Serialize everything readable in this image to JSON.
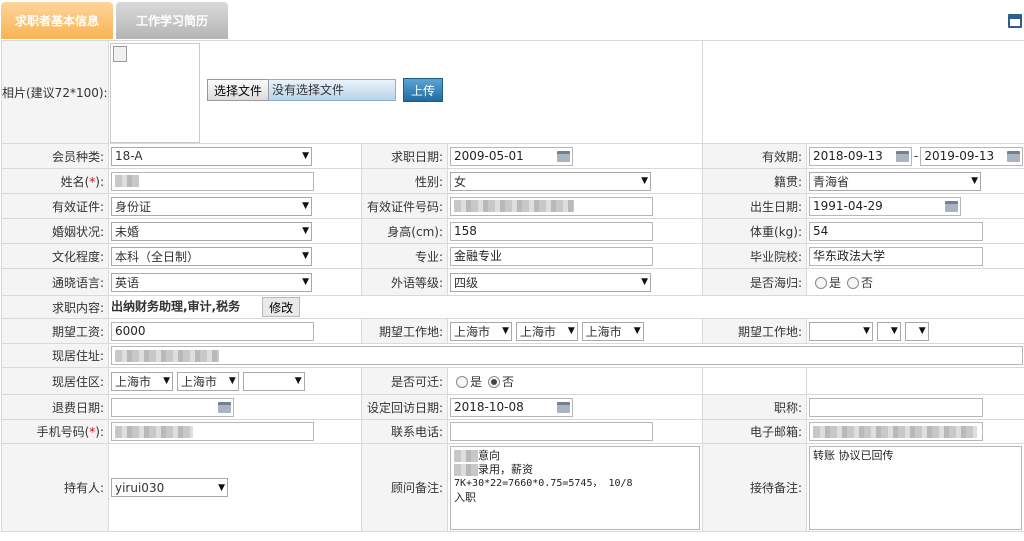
{
  "tabs": [
    "求职者基本信息",
    "工作学习简历"
  ],
  "photo": {
    "label": "相片(建议72*100):",
    "choose_btn": "选择文件",
    "no_file": "没有选择文件",
    "upload_btn": "上传"
  },
  "labels": {
    "member_type": "会员种类:",
    "apply_date": "求职日期:",
    "valid_period": "有效期:",
    "name_pre": "姓名(",
    "name_star": "*",
    "name_post": "):",
    "gender": "性别:",
    "native": "籍贯:",
    "id_type": "有效证件:",
    "id_number": "有效证件号码:",
    "birth": "出生日期:",
    "marital": "婚姻状况:",
    "height": "身高(cm):",
    "weight": "体重(kg):",
    "education": "文化程度:",
    "major": "专业:",
    "school": "毕业院校:",
    "language": "通晓语言:",
    "foreign_level": "外语等级:",
    "overseas": "是否海归:",
    "job_content": "求职内容:",
    "expected_salary": "期望工资:",
    "expected_place": "期望工作地:",
    "address": "现居住址:",
    "district": "现居住区:",
    "relocate": "是否可迁:",
    "refund_date": "退费日期:",
    "callback_date": "设定回访日期:",
    "title": "职称:",
    "mobile_pre": "手机号码(",
    "mobile_star": "*",
    "mobile_post": "):",
    "phone": "联系电话:",
    "email": "电子邮箱:",
    "holder": "持有人:",
    "consultant_note": "顾问备注:",
    "reception_note": "接待备注:",
    "yes": "是",
    "no": "否",
    "dash": "-"
  },
  "values": {
    "member_type": "18-A",
    "apply_date": "2009-05-01",
    "valid_from": "2018-09-13",
    "valid_to": "2019-09-13",
    "gender": "女",
    "native": "青海省",
    "id_type": "身份证",
    "birth": "1991-04-29",
    "marital": "未婚",
    "height": "158",
    "weight": "54",
    "education": "本科（全日制）",
    "major": "金融专业",
    "school": "华东政法大学",
    "language": "英语",
    "foreign_level": "四级",
    "job_content": "出纳财务助理,审计,税务",
    "edit_btn": "修改",
    "expected_salary": "6000",
    "place1_province": "上海市",
    "place1_city": "上海市",
    "place1_district": "上海市",
    "district_province": "上海市",
    "district_city": "上海市",
    "callback_date": "2018-10-08",
    "holder": "yirui030",
    "consultant_note_line1": "意向",
    "consultant_note_line2": "录用，薪资",
    "consultant_note_line3": "7K+30*22=7660*0.75=5745，   10/8",
    "consultant_note_line4": "入职",
    "reception_note": "转账  协议已回传"
  },
  "state": {
    "overseas": "none",
    "relocate": "no"
  }
}
